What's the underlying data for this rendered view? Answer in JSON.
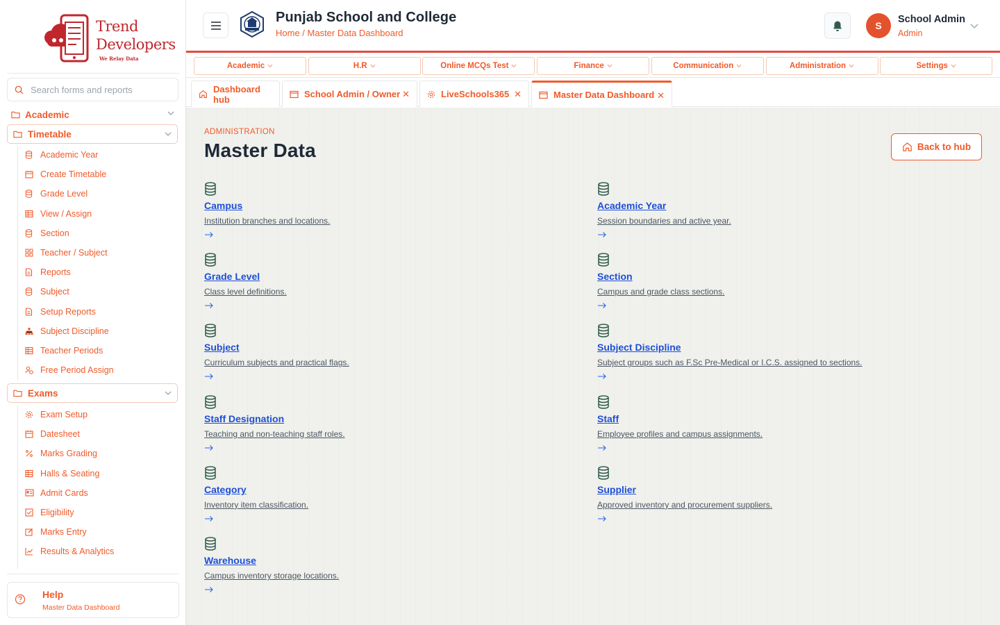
{
  "brand": {
    "line1": "Trend",
    "line2": "Developers",
    "tagline": "We Relay Data"
  },
  "search": {
    "placeholder": "Search forms and reports"
  },
  "sidebar": {
    "section": "Academic",
    "timetable": {
      "label": "Timetable",
      "items": [
        {
          "label": "Academic Year",
          "icon": "database-icon"
        },
        {
          "label": "Create Timetable",
          "icon": "calendar-icon"
        },
        {
          "label": "Grade Level",
          "icon": "database-icon"
        },
        {
          "label": "View / Assign",
          "icon": "table-icon"
        },
        {
          "label": "Section",
          "icon": "database-icon"
        },
        {
          "label": "Teacher / Subject",
          "icon": "grid-icon"
        },
        {
          "label": "Reports",
          "icon": "file-icon"
        },
        {
          "label": "Subject",
          "icon": "database-icon"
        },
        {
          "label": "Setup Reports",
          "icon": "file-icon"
        },
        {
          "label": "Subject Discipline",
          "icon": "hierarchy-icon"
        },
        {
          "label": "Teacher Periods",
          "icon": "table-icon"
        },
        {
          "label": "Free Period Assign",
          "icon": "user-clock-icon"
        }
      ]
    },
    "exams": {
      "label": "Exams",
      "items": [
        {
          "label": "Exam Setup",
          "icon": "gear-icon"
        },
        {
          "label": "Datesheet",
          "icon": "calendar-icon"
        },
        {
          "label": "Marks Grading",
          "icon": "percent-icon"
        },
        {
          "label": "Halls & Seating",
          "icon": "table-icon"
        },
        {
          "label": "Admit Cards",
          "icon": "id-card-icon"
        },
        {
          "label": "Eligibility",
          "icon": "check-square-icon"
        },
        {
          "label": "Marks Entry",
          "icon": "edit-icon"
        },
        {
          "label": "Results & Analytics",
          "icon": "chart-icon"
        }
      ]
    },
    "help": {
      "title": "Help",
      "subtitle": "Master Data Dashboard"
    }
  },
  "header": {
    "school_name": "Punjab School and College",
    "breadcrumb": "Home / Master Data Dashboard",
    "user": {
      "initial": "S",
      "name": "School Admin",
      "role": "Admin"
    }
  },
  "topnav": [
    {
      "label": "Academic"
    },
    {
      "label": "H.R"
    },
    {
      "label": "Online MCQs Test"
    },
    {
      "label": "Finance"
    },
    {
      "label": "Communication"
    },
    {
      "label": "Administration"
    },
    {
      "label": "Settings"
    }
  ],
  "tabs": [
    {
      "label": "Dashboard hub",
      "icon": "home-icon",
      "closable": false
    },
    {
      "label": "School Admin / Owner",
      "icon": "window-icon",
      "closable": true
    },
    {
      "label": "LiveSchools365",
      "icon": "gear-icon",
      "closable": true
    },
    {
      "label": "Master Data Dashboard",
      "icon": "window-icon",
      "closable": true,
      "active": true
    }
  ],
  "main": {
    "eyebrow": "ADMINISTRATION",
    "title": "Master Data",
    "back_label": "Back to hub",
    "cards": [
      {
        "title": "Campus",
        "desc": "Institution branches and locations."
      },
      {
        "title": "Academic Year",
        "desc": "Session boundaries and active year."
      },
      {
        "title": "Grade Level",
        "desc": "Class level definitions."
      },
      {
        "title": "Section",
        "desc": "Campus and grade class sections."
      },
      {
        "title": "Subject",
        "desc": "Curriculum subjects and practical flags."
      },
      {
        "title": "Subject Discipline",
        "desc": "Subject groups such as F.Sc Pre-Medical or I.C.S. assigned to sections."
      },
      {
        "title": "Staff Designation",
        "desc": "Teaching and non-teaching staff roles."
      },
      {
        "title": "Staff",
        "desc": "Employee profiles and campus assignments."
      },
      {
        "title": "Category",
        "desc": "Inventory item classification."
      },
      {
        "title": "Supplier",
        "desc": "Approved inventory and procurement suppliers."
      },
      {
        "title": "Warehouse",
        "desc": "Campus inventory storage locations."
      }
    ]
  },
  "colors": {
    "accent": "#f15a29",
    "link": "#1d4ed8",
    "header_rule": "#e4493f",
    "icon_green": "#2f5b4f"
  }
}
